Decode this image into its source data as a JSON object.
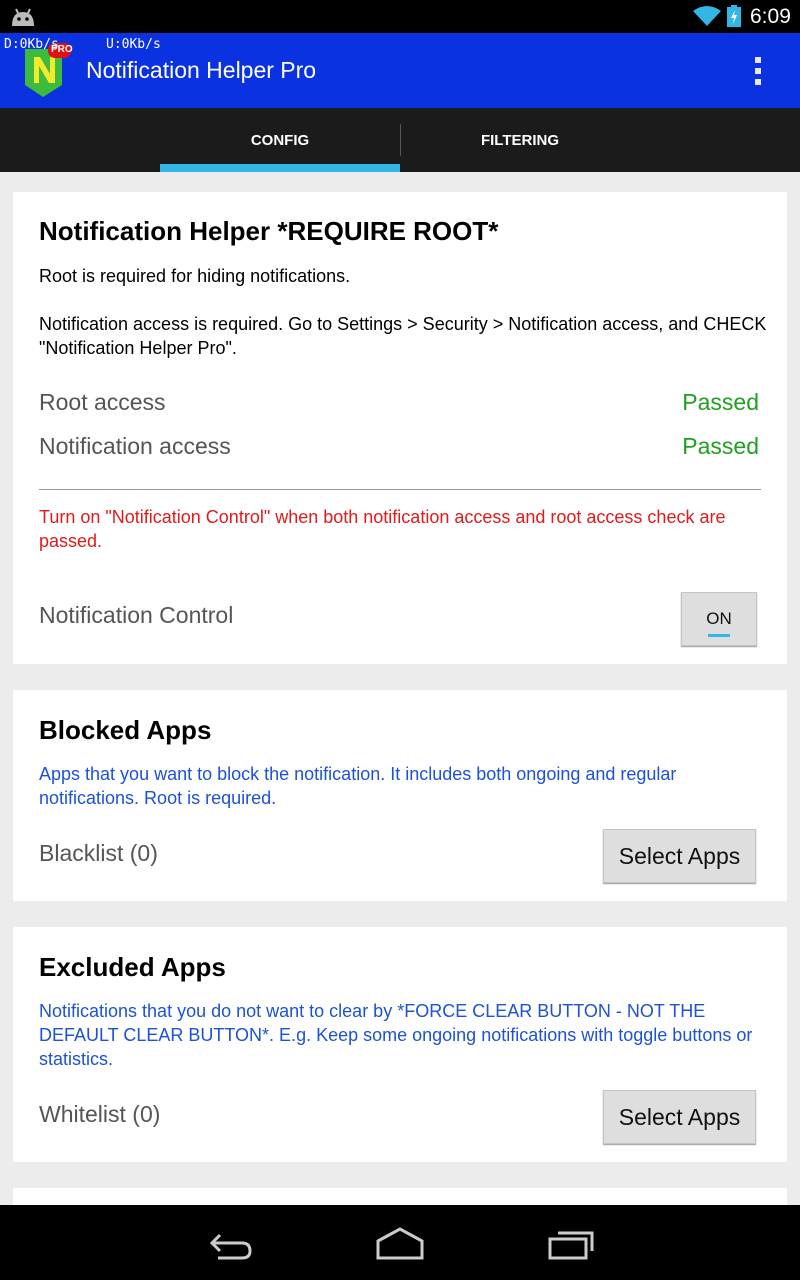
{
  "status_bar": {
    "net_down": "D:0Kb/s",
    "net_up": "U:0Kb/s",
    "time": "6:09",
    "icons": [
      "android-icon",
      "wifi-icon",
      "battery-charging-icon"
    ]
  },
  "action_bar": {
    "title": "Notification Helper Pro",
    "logo_letter": "N",
    "logo_badge": "PRO",
    "menu_icon": "overflow-menu-icon"
  },
  "tabs": [
    {
      "label": "CONFIG",
      "selected": true
    },
    {
      "label": "FILTERING",
      "selected": false
    }
  ],
  "config_card": {
    "title": "Notification Helper *REQUIRE ROOT*",
    "root_note": "Root is required for hiding notifications.",
    "access_note": "Notification access is required. Go to Settings > Security > Notification access, and CHECK \"Notification Helper Pro\".",
    "checks": [
      {
        "label": "Root access",
        "status": "Passed"
      },
      {
        "label": "Notification access",
        "status": "Passed"
      }
    ],
    "warning": "Turn on \"Notification Control\" when both notification access and root access check are passed.",
    "control_label": "Notification Control",
    "toggle_label": "ON"
  },
  "blocked_card": {
    "title": "Blocked Apps",
    "description": "Apps that you want to block the notification. It includes both ongoing and regular notifications. Root is required.",
    "list_label": "Blacklist (0)",
    "button_label": "Select Apps"
  },
  "excluded_card": {
    "title": "Excluded Apps",
    "description": "Notifications that you do not want to clear by *FORCE CLEAR BUTTON - NOT THE DEFAULT CLEAR BUTTON*. E.g. Keep some ongoing notifications with toggle buttons or statistics.",
    "list_label": "Whitelist (0)",
    "button_label": "Select Apps"
  },
  "nav_bar": {
    "icons": [
      "back-icon",
      "home-icon",
      "recent-apps-icon"
    ]
  },
  "colors": {
    "action_bar": "#0b32e0",
    "tab_indicator": "#33b5e5",
    "passed": "#20a020",
    "warning": "#e21a1a",
    "description": "#1c52d6"
  }
}
